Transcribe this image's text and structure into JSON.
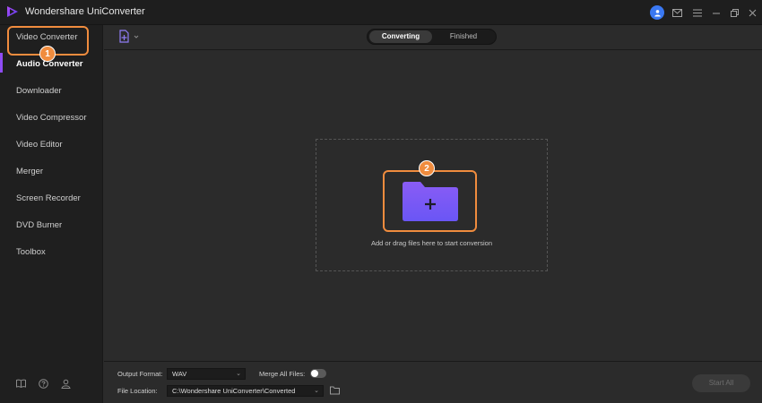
{
  "app": {
    "title": "Wondershare UniConverter"
  },
  "titlebar_icons": [
    "user-icon",
    "mail-icon",
    "menu-icon",
    "minimize-icon",
    "maximize-icon",
    "close-icon"
  ],
  "sidebar": {
    "items": [
      {
        "label": "Video Converter"
      },
      {
        "label": "Audio Converter",
        "active": true
      },
      {
        "label": "Downloader"
      },
      {
        "label": "Video Compressor"
      },
      {
        "label": "Video Editor"
      },
      {
        "label": "Merger"
      },
      {
        "label": "Screen Recorder"
      },
      {
        "label": "DVD Burner"
      },
      {
        "label": "Toolbox"
      }
    ],
    "bottom_icons": [
      "book-icon",
      "help-icon",
      "account-icon"
    ]
  },
  "callouts": {
    "step1": "1",
    "step2": "2"
  },
  "tabs": {
    "converting": "Converting",
    "finished": "Finished"
  },
  "dropzone": {
    "text": "Add or drag files here to start conversion"
  },
  "bottom": {
    "output_format_label": "Output Format:",
    "output_format_value": "WAV",
    "merge_label": "Merge All Files:",
    "file_location_label": "File Location:",
    "file_location_value": "C:\\Wondershare UniConverter\\Converted",
    "start_all": "Start All"
  },
  "colors": {
    "accent": "#8f4cf5",
    "callout": "#f08c3e",
    "folder": "#7a5cf5"
  }
}
